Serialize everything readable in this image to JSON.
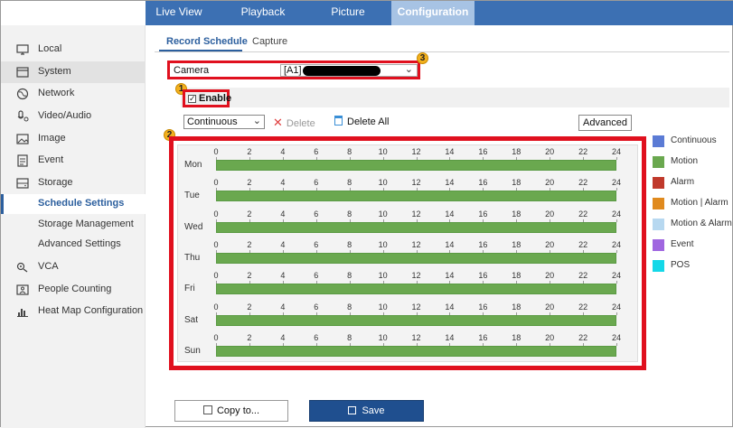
{
  "topnav": {
    "tabs": [
      {
        "label": "Live View"
      },
      {
        "label": "Playback"
      },
      {
        "label": "Picture"
      },
      {
        "label": "Configuration",
        "active": true
      }
    ]
  },
  "sidebar": {
    "items": [
      {
        "label": "Local",
        "icon": "monitor-icon"
      },
      {
        "label": "System",
        "icon": "system-icon"
      },
      {
        "label": "Network",
        "icon": "globe-icon"
      },
      {
        "label": "Video/Audio",
        "icon": "microphone-icon"
      },
      {
        "label": "Image",
        "icon": "image-icon"
      },
      {
        "label": "Event",
        "icon": "event-list-icon"
      },
      {
        "label": "Storage",
        "icon": "storage-icon"
      },
      {
        "label": "VCA",
        "icon": "vca-icon"
      },
      {
        "label": "People Counting",
        "icon": "people-counting-icon"
      },
      {
        "label": "Heat Map Configuration",
        "icon": "heat-map-icon"
      }
    ],
    "storage_sub": [
      {
        "label": "Schedule Settings",
        "active": true
      },
      {
        "label": "Storage Management"
      },
      {
        "label": "Advanced Settings"
      }
    ]
  },
  "subtabs": {
    "record_schedule": "Record Schedule",
    "capture": "Capture"
  },
  "camera": {
    "label": "Camera",
    "value": "[A1]"
  },
  "badges": [
    "1",
    "2",
    "3"
  ],
  "enable": {
    "label": "Enable",
    "checked": true,
    "check_glyph": "✓"
  },
  "toolbar": {
    "mode_value": "Continuous",
    "delete_label": "Delete",
    "delete_all_label": "Delete All",
    "advanced_label": "Advanced"
  },
  "schedule": {
    "days": [
      "Mon",
      "Tue",
      "Wed",
      "Thu",
      "Fri",
      "Sat",
      "Sun"
    ],
    "hour_ticks": [
      "0",
      "2",
      "4",
      "6",
      "8",
      "10",
      "12",
      "14",
      "16",
      "18",
      "20",
      "22",
      "24"
    ],
    "bar_type": "Motion",
    "bar_color": "#6aa84f",
    "bar_start_hour": 0,
    "bar_end_hour": 24
  },
  "legend": [
    {
      "label": "Continuous",
      "color": "#5b7bd5"
    },
    {
      "label": "Motion",
      "color": "#6aa84f"
    },
    {
      "label": "Alarm",
      "color": "#c0392b"
    },
    {
      "label": "Motion | Alarm",
      "color": "#e08a1e"
    },
    {
      "label": "Motion & Alarm",
      "color": "#b7d8f0"
    },
    {
      "label": "Event",
      "color": "#a066e0"
    },
    {
      "label": "POS",
      "color": "#14d8e8"
    }
  ],
  "buttons": {
    "copy_label": "Copy to...",
    "save_label": "Save"
  },
  "colors": {
    "nav_bg": "#3c70b3",
    "nav_active": "#a7c3e4",
    "highlight_red": "#e0101e",
    "badge_yellow": "#f2b01e",
    "save_bg": "#1f4f8f"
  }
}
